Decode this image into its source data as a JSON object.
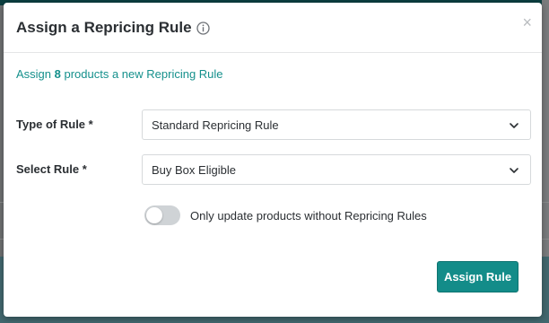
{
  "modal": {
    "title": "Assign a Repricing Rule",
    "title_icon": "info-icon",
    "close_icon": "close-icon",
    "close_glyph": "×",
    "subtitle_prefix": "Assign ",
    "subtitle_count": "8",
    "subtitle_suffix": " products a new Repricing Rule"
  },
  "form": {
    "type_of_rule": {
      "label": "Type of Rule *",
      "value": "Standard Repricing Rule"
    },
    "select_rule": {
      "label": "Select Rule *",
      "value": "Buy Box Eligible"
    },
    "toggle": {
      "label": "Only update products without Repricing Rules",
      "on": false
    }
  },
  "actions": {
    "assign_label": "Assign Rule"
  },
  "colors": {
    "accent": "#138c89",
    "subtitle_text": "#15908c",
    "toggle_off": "#cfd3d6"
  }
}
